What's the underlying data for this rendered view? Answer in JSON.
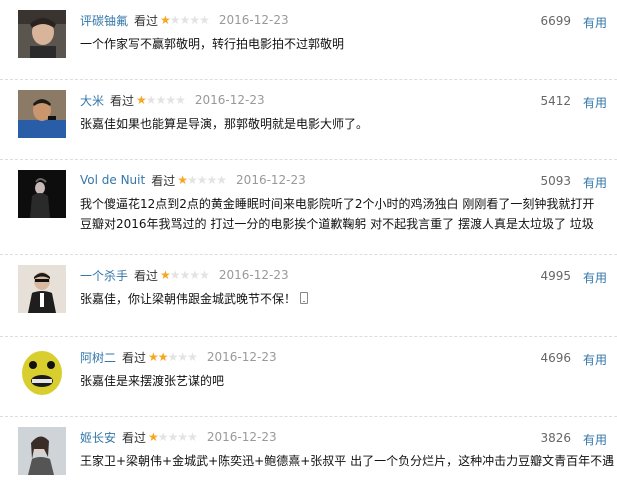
{
  "reviews": [
    {
      "username": "评碳铀氟",
      "watched": "看过",
      "rating": 1,
      "date": "2016-12-23",
      "votes": "6699",
      "useful": "有用",
      "content": "一个作家写不赢郭敬明，转行拍电影拍不过郭敬明"
    },
    {
      "username": "大米",
      "watched": "看过",
      "rating": 1,
      "date": "2016-12-23",
      "votes": "5412",
      "useful": "有用",
      "content": "张嘉佳如果也能算是导演，那郭敬明就是电影大师了。"
    },
    {
      "username": "Vol de Nuit",
      "watched": "看过",
      "rating": 1,
      "date": "2016-12-23",
      "votes": "5093",
      "useful": "有用",
      "content": "我个傻逼花12点到2点的黄金睡眠时间来电影院听了2个小时的鸡汤独白 刚刚看了一刻钟我就打开豆瓣对2016年我骂过的 打过一分的电影挨个道歉鞠躬 对不起我言重了 摆渡人真是太垃圾了 垃圾"
    },
    {
      "username": "一个杀手",
      "watched": "看过",
      "rating": 1,
      "date": "2016-12-23",
      "votes": "4995",
      "useful": "有用",
      "content": "张嘉佳，你让梁朝伟跟金城武晚节不保！"
    },
    {
      "username": "阿树二",
      "watched": "看过",
      "rating": 2,
      "date": "2016-12-23",
      "votes": "4696",
      "useful": "有用",
      "content": "张嘉佳是来摆渡张艺谋的吧"
    },
    {
      "username": "姬长安",
      "watched": "看过",
      "rating": 1,
      "date": "2016-12-23",
      "votes": "3826",
      "useful": "有用",
      "content": "王家卫+梁朝伟+金城武+陈奕迅+鲍德熹+张叔平 出了一个负分烂片，这种冲击力豆瓣文青百年不遇"
    }
  ],
  "colors": {
    "link": "#3377aa",
    "star_on": "#f5a623",
    "star_off": "#e3e3e3",
    "date": "#999999"
  }
}
